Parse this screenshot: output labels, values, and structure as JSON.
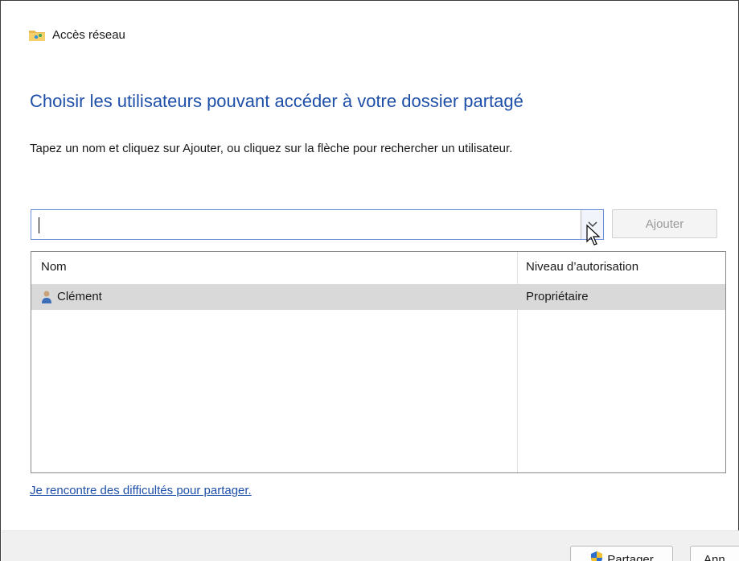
{
  "window": {
    "title": "Accès réseau",
    "title_icon": "folder-share-icon"
  },
  "main": {
    "heading": "Choisir les utilisateurs pouvant accéder à votre dossier partagé",
    "instruction": "Tapez un nom et cliquez sur Ajouter, ou cliquez sur la flèche pour rechercher un utilisateur."
  },
  "user_input": {
    "value": "",
    "placeholder": "",
    "arrow_icon": "chevron-down-icon"
  },
  "add_button": {
    "label": "Ajouter"
  },
  "users_table": {
    "columns": [
      "Nom",
      "Niveau d’autorisation"
    ],
    "rows": [
      {
        "name": "Clément",
        "permission": "Propriétaire",
        "icon": "user-icon"
      }
    ]
  },
  "help_link": "Je rencontre des difficultés pour partager.",
  "footer": {
    "share_label": "Partager",
    "share_icon": "uac-shield-icon",
    "cancel_label": "Ann"
  },
  "colors": {
    "accent": "#1e4fa8",
    "selected_row": "#d9d9d9",
    "input_border": "#6b8fd6"
  }
}
